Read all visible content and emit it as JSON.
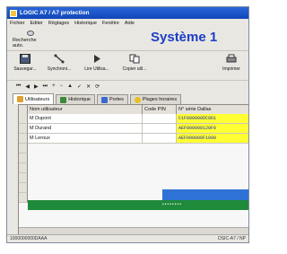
{
  "window": {
    "title": "LOGIC A7 / A7 protection"
  },
  "menu": [
    "Fichier",
    "Editer",
    "Réglages",
    "Historique",
    "Fenêtre",
    "Aide"
  ],
  "recherche_label": "Recherche auto.",
  "system_title": "Système 1",
  "toolbar": [
    {
      "label": "Sauvegar...",
      "icon": "save-icon"
    },
    {
      "label": "Synchroni...",
      "icon": "sync-icon"
    },
    {
      "label": "Lire Utilisa...",
      "icon": "read-users-icon"
    },
    {
      "label": "Copier util...",
      "icon": "copy-user-icon"
    },
    {
      "label": "Imprimer",
      "icon": "printer-icon"
    }
  ],
  "nav_symbols": [
    "⏮",
    "◀",
    "▶",
    "⏭",
    "+",
    "−",
    "▲",
    "✓",
    "✕",
    "⟳"
  ],
  "tabs": [
    {
      "label": "Utilisateurs",
      "icon": "users-icon",
      "color": "#e0a030",
      "active": true
    },
    {
      "label": "Historique",
      "icon": "history-icon",
      "color": "#3a8a3a",
      "active": false
    },
    {
      "label": "Portes",
      "icon": "door-icon",
      "color": "#3a6ad0",
      "active": false
    },
    {
      "label": "Plages horaires",
      "icon": "clock-icon",
      "color": "#e8c020",
      "active": false
    }
  ],
  "grid": {
    "columns": [
      "Nom utilisateur",
      "Code PIN",
      "N° série Dallas"
    ],
    "rows": [
      {
        "name": "M Dupont",
        "pin": "",
        "dallas": "C1F000000DC0D1"
      },
      {
        "name": "M Durand",
        "pin": "",
        "dallas": "AEF000000120F0"
      },
      {
        "name": "M Leroux",
        "pin": "",
        "dallas": "AEF000000F1090"
      }
    ],
    "masked_pin": "••••••••"
  },
  "status": {
    "left": "1000000000DAAA",
    "right": "DSIC-A7 / NP"
  },
  "colors": {
    "title_blue": "#1b3fc6",
    "dallas_yellow": "#ffff33",
    "selection_blue": "#2f72d6",
    "green_row": "#1f8a3a"
  }
}
